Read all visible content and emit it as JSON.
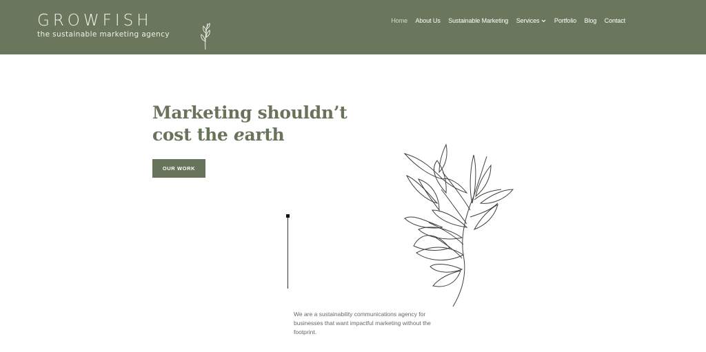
{
  "brand": {
    "name": "GROWFISH",
    "tagline": "the sustainable marketing agency",
    "logo_icon": "leaf-sprig-icon"
  },
  "nav": {
    "items": [
      {
        "label": "Home",
        "active": true
      },
      {
        "label": "About Us"
      },
      {
        "label": "Sustainable Marketing"
      },
      {
        "label": "Services",
        "dropdown": true
      },
      {
        "label": "Portfolio"
      },
      {
        "label": "Blog"
      },
      {
        "label": "Contact"
      }
    ],
    "dropdown_icon": "chevron-down-icon"
  },
  "hero": {
    "title_line1": "Marketing shouldn’t",
    "title_line2_prefix": "cost the ",
    "title_line2_italic": "e",
    "title_line2_suffix": "arth",
    "cta_label": "OUR WORK"
  },
  "illustration": {
    "icon": "leaf-branch-icon"
  },
  "intro": {
    "text": "We are a sustainability communications agency for businesses that want impactful marketing without the footprint."
  },
  "colors": {
    "header_bg": "#6b775d",
    "accent": "#67735a",
    "nav_text": "#ffffff",
    "nav_active": "#d6dccd",
    "body_text": "#666666"
  }
}
